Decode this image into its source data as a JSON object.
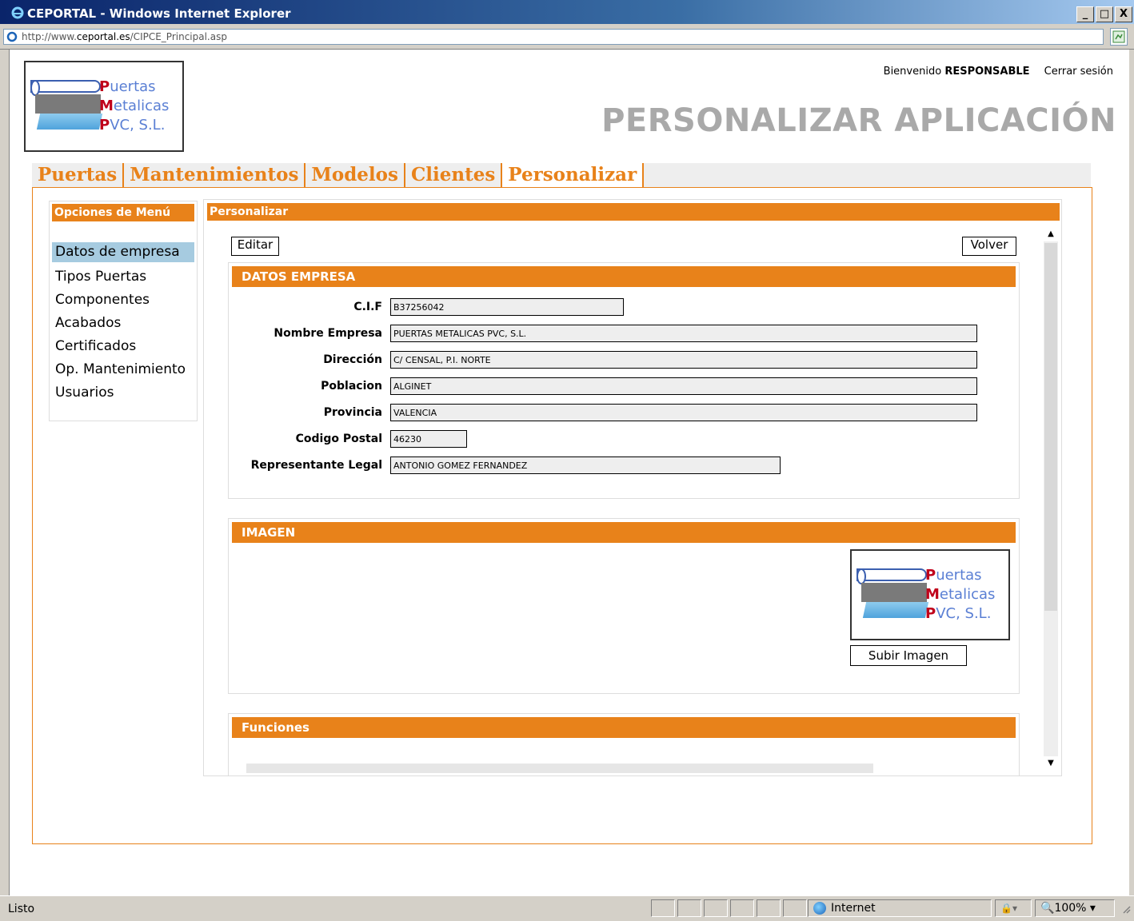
{
  "window": {
    "title": "CEPORTAL - Windows Internet Explorer",
    "minimize": "_",
    "maximize": "□",
    "close": "X"
  },
  "address": {
    "prefix": "http://www.",
    "domain": "ceportal.es",
    "path": "/CIPCE_Principal.asp"
  },
  "header": {
    "welcome_label": "Bienvenido",
    "user": "RESPONSABLE",
    "logout": "Cerrar sesión",
    "page_title": "PERSONALIZAR APLICACIÓN"
  },
  "logo": {
    "line1_cap": "P",
    "line1_rest": "uertas",
    "line2_cap": "M",
    "line2_rest": "etalicas",
    "line3_cap": "P",
    "line3_rest": "VC, S.L."
  },
  "tabs": [
    {
      "label": "Puertas"
    },
    {
      "label": "Mantenimientos"
    },
    {
      "label": "Modelos"
    },
    {
      "label": "Clientes"
    },
    {
      "label": "Personalizar",
      "active": true
    }
  ],
  "sidemenu": {
    "header": "Opciones de Menú",
    "items": [
      {
        "label": "Datos de empresa",
        "selected": true
      },
      {
        "label": "Tipos Puertas"
      },
      {
        "label": "Componentes"
      },
      {
        "label": "Acabados"
      },
      {
        "label": "Certificados"
      },
      {
        "label": "Op. Mantenimiento"
      },
      {
        "label": "Usuarios"
      }
    ]
  },
  "panel": {
    "header": "Personalizar",
    "edit_button": "Editar",
    "back_button": "Volver"
  },
  "datos": {
    "header": "DATOS EMPRESA",
    "fields": [
      {
        "label": "C.I.F",
        "value": "B37256042"
      },
      {
        "label": "Nombre Empresa",
        "value": "PUERTAS METALICAS PVC, S.L."
      },
      {
        "label": "Dirección",
        "value": "C/ CENSAL, P.I. NORTE"
      },
      {
        "label": "Poblacion",
        "value": "ALGINET"
      },
      {
        "label": "Provincia",
        "value": "VALENCIA"
      },
      {
        "label": "Codigo Postal",
        "value": "46230"
      },
      {
        "label": "Representante Legal",
        "value": "ANTONIO GOMEZ FERNANDEZ"
      }
    ]
  },
  "imagen": {
    "header": "IMAGEN",
    "upload_button": "Subir Imagen"
  },
  "funciones": {
    "header": "Funciones"
  },
  "statusbar": {
    "status": "Listo",
    "zone": "Internet",
    "zoom": "100%"
  },
  "colors": {
    "accent": "#e8821a",
    "selected_item": "#a6cbe0",
    "title_grey": "#a9a9a9"
  }
}
